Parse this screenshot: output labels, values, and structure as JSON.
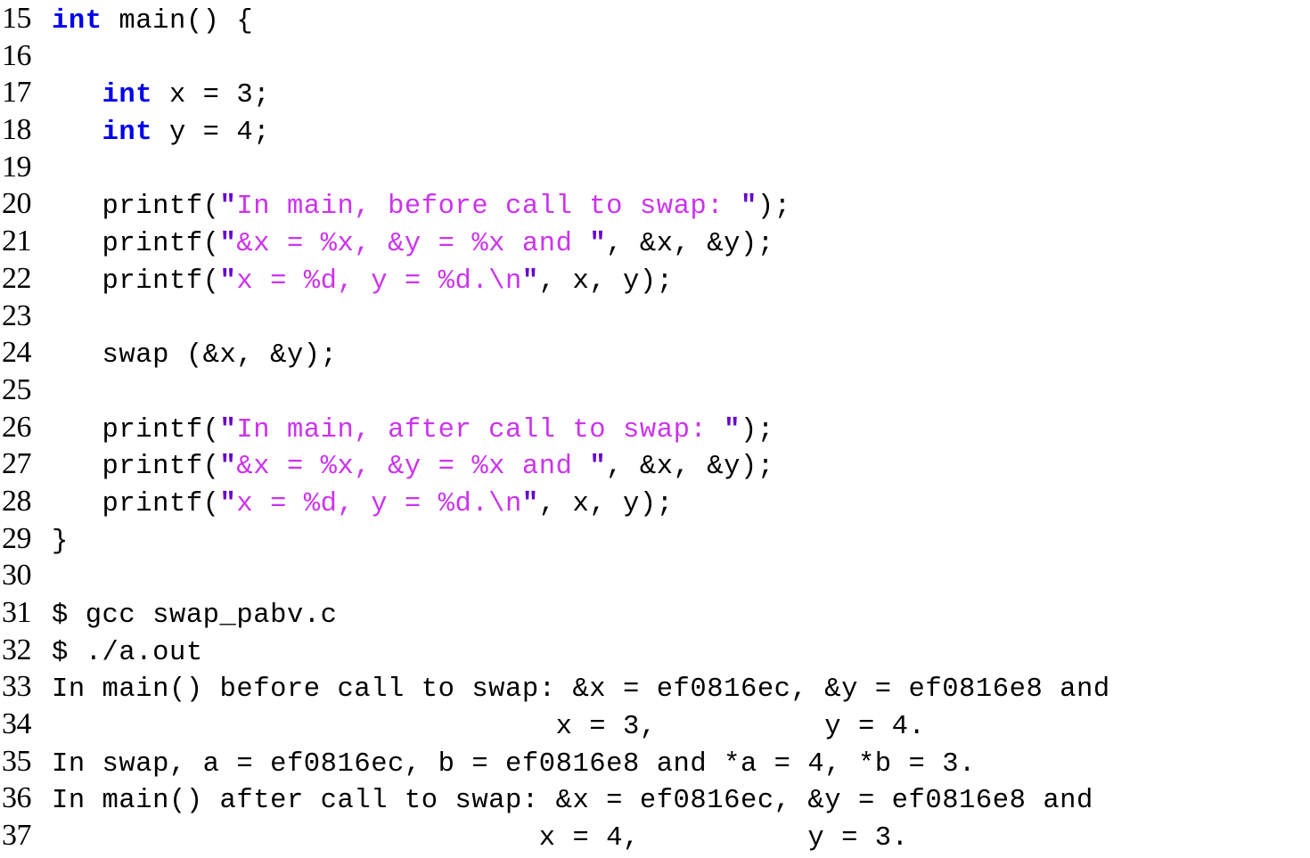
{
  "view": {
    "kind": "code-listing-with-terminal-output",
    "background": "#ffffff",
    "first_line_number": 15,
    "last_line_number": 37,
    "colors": {
      "keyword": "#0000ee",
      "string": "#cc33ee",
      "quote": "#6600cc",
      "text": "#000000",
      "background": "#ffffff"
    }
  },
  "lines": [
    {
      "number": "15",
      "segments": [
        {
          "kind": "keyword",
          "text": "int"
        },
        {
          "kind": "plain",
          "text": " main() {"
        }
      ]
    },
    {
      "number": "16",
      "segments": []
    },
    {
      "number": "17",
      "segments": [
        {
          "kind": "plain",
          "text": "   "
        },
        {
          "kind": "keyword",
          "text": "int"
        },
        {
          "kind": "plain",
          "text": " x = 3;"
        }
      ]
    },
    {
      "number": "18",
      "segments": [
        {
          "kind": "plain",
          "text": "   "
        },
        {
          "kind": "keyword",
          "text": "int"
        },
        {
          "kind": "plain",
          "text": " y = 4;"
        }
      ]
    },
    {
      "number": "19",
      "segments": []
    },
    {
      "number": "20",
      "segments": [
        {
          "kind": "plain",
          "text": "   printf("
        },
        {
          "kind": "quote",
          "text": "\""
        },
        {
          "kind": "string",
          "text": "In main, before call to swap: "
        },
        {
          "kind": "quote",
          "text": "\""
        },
        {
          "kind": "plain",
          "text": ");"
        }
      ]
    },
    {
      "number": "21",
      "segments": [
        {
          "kind": "plain",
          "text": "   printf("
        },
        {
          "kind": "quote",
          "text": "\""
        },
        {
          "kind": "string",
          "text": "&x = %x, &y = %x and "
        },
        {
          "kind": "quote",
          "text": "\""
        },
        {
          "kind": "plain",
          "text": ", &x, &y);"
        }
      ]
    },
    {
      "number": "22",
      "segments": [
        {
          "kind": "plain",
          "text": "   printf("
        },
        {
          "kind": "quote",
          "text": "\""
        },
        {
          "kind": "string",
          "text": "x = %d, y = %d.\\n"
        },
        {
          "kind": "quote",
          "text": "\""
        },
        {
          "kind": "plain",
          "text": ", x, y);"
        }
      ]
    },
    {
      "number": "23",
      "segments": []
    },
    {
      "number": "24",
      "segments": [
        {
          "kind": "plain",
          "text": "   swap (&x, &y);"
        }
      ]
    },
    {
      "number": "25",
      "segments": []
    },
    {
      "number": "26",
      "segments": [
        {
          "kind": "plain",
          "text": "   printf("
        },
        {
          "kind": "quote",
          "text": "\""
        },
        {
          "kind": "string",
          "text": "In main, after call to swap: "
        },
        {
          "kind": "quote",
          "text": "\""
        },
        {
          "kind": "plain",
          "text": ");"
        }
      ]
    },
    {
      "number": "27",
      "segments": [
        {
          "kind": "plain",
          "text": "   printf("
        },
        {
          "kind": "quote",
          "text": "\""
        },
        {
          "kind": "string",
          "text": "&x = %x, &y = %x and "
        },
        {
          "kind": "quote",
          "text": "\""
        },
        {
          "kind": "plain",
          "text": ", &x, &y);"
        }
      ]
    },
    {
      "number": "28",
      "segments": [
        {
          "kind": "plain",
          "text": "   printf("
        },
        {
          "kind": "quote",
          "text": "\""
        },
        {
          "kind": "string",
          "text": "x = %d, y = %d.\\n"
        },
        {
          "kind": "quote",
          "text": "\""
        },
        {
          "kind": "plain",
          "text": ", x, y);"
        }
      ]
    },
    {
      "number": "29",
      "segments": [
        {
          "kind": "plain",
          "text": "}"
        }
      ]
    },
    {
      "number": "30",
      "segments": []
    },
    {
      "number": "31",
      "segments": [
        {
          "kind": "out",
          "text": "$ gcc swap_pabv.c"
        }
      ]
    },
    {
      "number": "32",
      "segments": [
        {
          "kind": "out",
          "text": "$ ./a.out"
        }
      ]
    },
    {
      "number": "33",
      "segments": [
        {
          "kind": "out",
          "text": "In main() before call to swap: &x = ef0816ec, &y = ef0816e8 and"
        }
      ]
    },
    {
      "number": "34",
      "segments": [
        {
          "kind": "out",
          "text": "                              x = 3,          y = 4."
        }
      ]
    },
    {
      "number": "35",
      "segments": [
        {
          "kind": "out",
          "text": "In swap, a = ef0816ec, b = ef0816e8 and *a = 4, *b = 3."
        }
      ]
    },
    {
      "number": "36",
      "segments": [
        {
          "kind": "out",
          "text": "In main() after call to swap: &x = ef0816ec, &y = ef0816e8 and"
        }
      ]
    },
    {
      "number": "37",
      "segments": [
        {
          "kind": "out",
          "text": "                             x = 4,          y = 3."
        }
      ]
    }
  ]
}
